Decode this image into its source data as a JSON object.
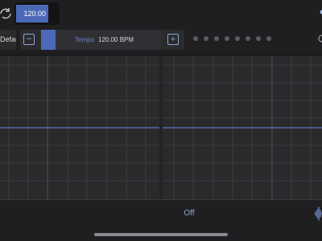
{
  "header": {
    "tempo_field_value": "120.00"
  },
  "controls": {
    "default_label": "Default",
    "tempo_label": "Tempo",
    "tempo_value": "120.00 BPM",
    "tempo_slider_level": 0.12,
    "minus_symbol": "−",
    "plus_symbol": "+",
    "page_dots": 8
  },
  "status": {
    "text": "Off"
  },
  "icons": {
    "refresh": "refresh-icon",
    "minus": "minus-icon",
    "plus": "plus-icon",
    "waveform": "waveform-icon"
  },
  "colors": {
    "accent": "#4a6ab8",
    "accent_text": "#8fa6d6",
    "trace": "#5b78c4",
    "background": "#1c1c1e"
  }
}
